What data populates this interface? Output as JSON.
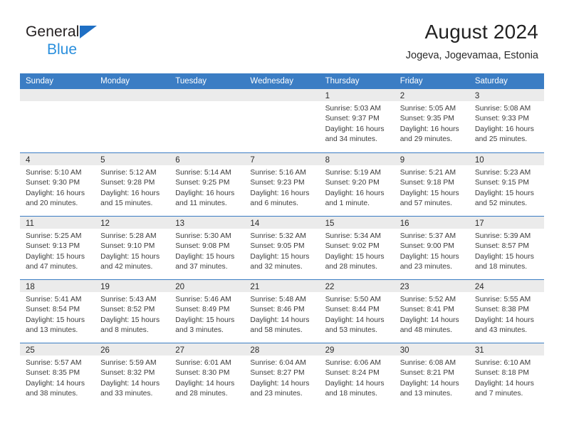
{
  "brand": {
    "name_part1": "General",
    "name_part2": "Blue",
    "triangle_color": "#1f6fc4",
    "accent_color": "#2a8fdd"
  },
  "header": {
    "month_title": "August 2024",
    "location": "Jogeva, Jogevamaa, Estonia"
  },
  "theme": {
    "header_blue": "#3b7dc4",
    "day_band_gray": "#ebebeb",
    "text_color": "#3c3c3c"
  },
  "calendar": {
    "weekday_headers": [
      "Sunday",
      "Monday",
      "Tuesday",
      "Wednesday",
      "Thursday",
      "Friday",
      "Saturday"
    ],
    "weeks": [
      [
        {
          "day": "",
          "lines": []
        },
        {
          "day": "",
          "lines": []
        },
        {
          "day": "",
          "lines": []
        },
        {
          "day": "",
          "lines": []
        },
        {
          "day": "1",
          "lines": [
            "Sunrise: 5:03 AM",
            "Sunset: 9:37 PM",
            "Daylight: 16 hours",
            "and 34 minutes."
          ]
        },
        {
          "day": "2",
          "lines": [
            "Sunrise: 5:05 AM",
            "Sunset: 9:35 PM",
            "Daylight: 16 hours",
            "and 29 minutes."
          ]
        },
        {
          "day": "3",
          "lines": [
            "Sunrise: 5:08 AM",
            "Sunset: 9:33 PM",
            "Daylight: 16 hours",
            "and 25 minutes."
          ]
        }
      ],
      [
        {
          "day": "4",
          "lines": [
            "Sunrise: 5:10 AM",
            "Sunset: 9:30 PM",
            "Daylight: 16 hours",
            "and 20 minutes."
          ]
        },
        {
          "day": "5",
          "lines": [
            "Sunrise: 5:12 AM",
            "Sunset: 9:28 PM",
            "Daylight: 16 hours",
            "and 15 minutes."
          ]
        },
        {
          "day": "6",
          "lines": [
            "Sunrise: 5:14 AM",
            "Sunset: 9:25 PM",
            "Daylight: 16 hours",
            "and 11 minutes."
          ]
        },
        {
          "day": "7",
          "lines": [
            "Sunrise: 5:16 AM",
            "Sunset: 9:23 PM",
            "Daylight: 16 hours",
            "and 6 minutes."
          ]
        },
        {
          "day": "8",
          "lines": [
            "Sunrise: 5:19 AM",
            "Sunset: 9:20 PM",
            "Daylight: 16 hours",
            "and 1 minute."
          ]
        },
        {
          "day": "9",
          "lines": [
            "Sunrise: 5:21 AM",
            "Sunset: 9:18 PM",
            "Daylight: 15 hours",
            "and 57 minutes."
          ]
        },
        {
          "day": "10",
          "lines": [
            "Sunrise: 5:23 AM",
            "Sunset: 9:15 PM",
            "Daylight: 15 hours",
            "and 52 minutes."
          ]
        }
      ],
      [
        {
          "day": "11",
          "lines": [
            "Sunrise: 5:25 AM",
            "Sunset: 9:13 PM",
            "Daylight: 15 hours",
            "and 47 minutes."
          ]
        },
        {
          "day": "12",
          "lines": [
            "Sunrise: 5:28 AM",
            "Sunset: 9:10 PM",
            "Daylight: 15 hours",
            "and 42 minutes."
          ]
        },
        {
          "day": "13",
          "lines": [
            "Sunrise: 5:30 AM",
            "Sunset: 9:08 PM",
            "Daylight: 15 hours",
            "and 37 minutes."
          ]
        },
        {
          "day": "14",
          "lines": [
            "Sunrise: 5:32 AM",
            "Sunset: 9:05 PM",
            "Daylight: 15 hours",
            "and 32 minutes."
          ]
        },
        {
          "day": "15",
          "lines": [
            "Sunrise: 5:34 AM",
            "Sunset: 9:02 PM",
            "Daylight: 15 hours",
            "and 28 minutes."
          ]
        },
        {
          "day": "16",
          "lines": [
            "Sunrise: 5:37 AM",
            "Sunset: 9:00 PM",
            "Daylight: 15 hours",
            "and 23 minutes."
          ]
        },
        {
          "day": "17",
          "lines": [
            "Sunrise: 5:39 AM",
            "Sunset: 8:57 PM",
            "Daylight: 15 hours",
            "and 18 minutes."
          ]
        }
      ],
      [
        {
          "day": "18",
          "lines": [
            "Sunrise: 5:41 AM",
            "Sunset: 8:54 PM",
            "Daylight: 15 hours",
            "and 13 minutes."
          ]
        },
        {
          "day": "19",
          "lines": [
            "Sunrise: 5:43 AM",
            "Sunset: 8:52 PM",
            "Daylight: 15 hours",
            "and 8 minutes."
          ]
        },
        {
          "day": "20",
          "lines": [
            "Sunrise: 5:46 AM",
            "Sunset: 8:49 PM",
            "Daylight: 15 hours",
            "and 3 minutes."
          ]
        },
        {
          "day": "21",
          "lines": [
            "Sunrise: 5:48 AM",
            "Sunset: 8:46 PM",
            "Daylight: 14 hours",
            "and 58 minutes."
          ]
        },
        {
          "day": "22",
          "lines": [
            "Sunrise: 5:50 AM",
            "Sunset: 8:44 PM",
            "Daylight: 14 hours",
            "and 53 minutes."
          ]
        },
        {
          "day": "23",
          "lines": [
            "Sunrise: 5:52 AM",
            "Sunset: 8:41 PM",
            "Daylight: 14 hours",
            "and 48 minutes."
          ]
        },
        {
          "day": "24",
          "lines": [
            "Sunrise: 5:55 AM",
            "Sunset: 8:38 PM",
            "Daylight: 14 hours",
            "and 43 minutes."
          ]
        }
      ],
      [
        {
          "day": "25",
          "lines": [
            "Sunrise: 5:57 AM",
            "Sunset: 8:35 PM",
            "Daylight: 14 hours",
            "and 38 minutes."
          ]
        },
        {
          "day": "26",
          "lines": [
            "Sunrise: 5:59 AM",
            "Sunset: 8:32 PM",
            "Daylight: 14 hours",
            "and 33 minutes."
          ]
        },
        {
          "day": "27",
          "lines": [
            "Sunrise: 6:01 AM",
            "Sunset: 8:30 PM",
            "Daylight: 14 hours",
            "and 28 minutes."
          ]
        },
        {
          "day": "28",
          "lines": [
            "Sunrise: 6:04 AM",
            "Sunset: 8:27 PM",
            "Daylight: 14 hours",
            "and 23 minutes."
          ]
        },
        {
          "day": "29",
          "lines": [
            "Sunrise: 6:06 AM",
            "Sunset: 8:24 PM",
            "Daylight: 14 hours",
            "and 18 minutes."
          ]
        },
        {
          "day": "30",
          "lines": [
            "Sunrise: 6:08 AM",
            "Sunset: 8:21 PM",
            "Daylight: 14 hours",
            "and 13 minutes."
          ]
        },
        {
          "day": "31",
          "lines": [
            "Sunrise: 6:10 AM",
            "Sunset: 8:18 PM",
            "Daylight: 14 hours",
            "and 7 minutes."
          ]
        }
      ]
    ]
  }
}
